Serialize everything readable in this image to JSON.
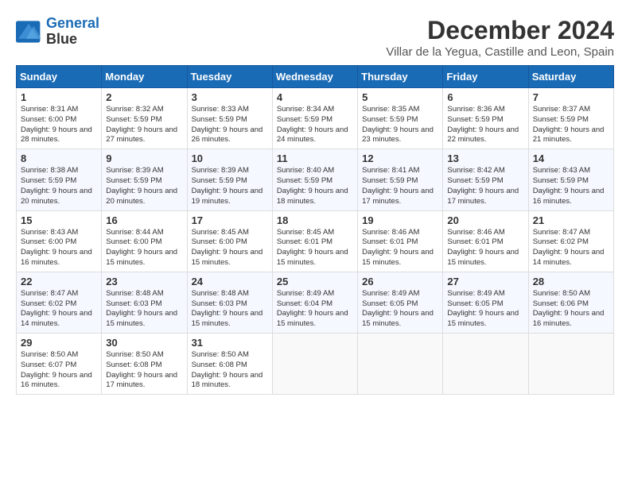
{
  "header": {
    "logo_line1": "General",
    "logo_line2": "Blue",
    "main_title": "December 2024",
    "subtitle": "Villar de la Yegua, Castille and Leon, Spain"
  },
  "weekdays": [
    "Sunday",
    "Monday",
    "Tuesday",
    "Wednesday",
    "Thursday",
    "Friday",
    "Saturday"
  ],
  "weeks": [
    [
      {
        "day": "1",
        "sunrise": "8:31 AM",
        "sunset": "6:00 PM",
        "daylight": "9 hours and 28 minutes."
      },
      {
        "day": "2",
        "sunrise": "8:32 AM",
        "sunset": "5:59 PM",
        "daylight": "9 hours and 27 minutes."
      },
      {
        "day": "3",
        "sunrise": "8:33 AM",
        "sunset": "5:59 PM",
        "daylight": "9 hours and 26 minutes."
      },
      {
        "day": "4",
        "sunrise": "8:34 AM",
        "sunset": "5:59 PM",
        "daylight": "9 hours and 24 minutes."
      },
      {
        "day": "5",
        "sunrise": "8:35 AM",
        "sunset": "5:59 PM",
        "daylight": "9 hours and 23 minutes."
      },
      {
        "day": "6",
        "sunrise": "8:36 AM",
        "sunset": "5:59 PM",
        "daylight": "9 hours and 22 minutes."
      },
      {
        "day": "7",
        "sunrise": "8:37 AM",
        "sunset": "5:59 PM",
        "daylight": "9 hours and 21 minutes."
      }
    ],
    [
      {
        "day": "8",
        "sunrise": "8:38 AM",
        "sunset": "5:59 PM",
        "daylight": "9 hours and 20 minutes."
      },
      {
        "day": "9",
        "sunrise": "8:39 AM",
        "sunset": "5:59 PM",
        "daylight": "9 hours and 20 minutes."
      },
      {
        "day": "10",
        "sunrise": "8:39 AM",
        "sunset": "5:59 PM",
        "daylight": "9 hours and 19 minutes."
      },
      {
        "day": "11",
        "sunrise": "8:40 AM",
        "sunset": "5:59 PM",
        "daylight": "9 hours and 18 minutes."
      },
      {
        "day": "12",
        "sunrise": "8:41 AM",
        "sunset": "5:59 PM",
        "daylight": "9 hours and 17 minutes."
      },
      {
        "day": "13",
        "sunrise": "8:42 AM",
        "sunset": "5:59 PM",
        "daylight": "9 hours and 17 minutes."
      },
      {
        "day": "14",
        "sunrise": "8:43 AM",
        "sunset": "5:59 PM",
        "daylight": "9 hours and 16 minutes."
      }
    ],
    [
      {
        "day": "15",
        "sunrise": "8:43 AM",
        "sunset": "6:00 PM",
        "daylight": "9 hours and 16 minutes."
      },
      {
        "day": "16",
        "sunrise": "8:44 AM",
        "sunset": "6:00 PM",
        "daylight": "9 hours and 15 minutes."
      },
      {
        "day": "17",
        "sunrise": "8:45 AM",
        "sunset": "6:00 PM",
        "daylight": "9 hours and 15 minutes."
      },
      {
        "day": "18",
        "sunrise": "8:45 AM",
        "sunset": "6:01 PM",
        "daylight": "9 hours and 15 minutes."
      },
      {
        "day": "19",
        "sunrise": "8:46 AM",
        "sunset": "6:01 PM",
        "daylight": "9 hours and 15 minutes."
      },
      {
        "day": "20",
        "sunrise": "8:46 AM",
        "sunset": "6:01 PM",
        "daylight": "9 hours and 15 minutes."
      },
      {
        "day": "21",
        "sunrise": "8:47 AM",
        "sunset": "6:02 PM",
        "daylight": "9 hours and 14 minutes."
      }
    ],
    [
      {
        "day": "22",
        "sunrise": "8:47 AM",
        "sunset": "6:02 PM",
        "daylight": "9 hours and 14 minutes."
      },
      {
        "day": "23",
        "sunrise": "8:48 AM",
        "sunset": "6:03 PM",
        "daylight": "9 hours and 15 minutes."
      },
      {
        "day": "24",
        "sunrise": "8:48 AM",
        "sunset": "6:03 PM",
        "daylight": "9 hours and 15 minutes."
      },
      {
        "day": "25",
        "sunrise": "8:49 AM",
        "sunset": "6:04 PM",
        "daylight": "9 hours and 15 minutes."
      },
      {
        "day": "26",
        "sunrise": "8:49 AM",
        "sunset": "6:05 PM",
        "daylight": "9 hours and 15 minutes."
      },
      {
        "day": "27",
        "sunrise": "8:49 AM",
        "sunset": "6:05 PM",
        "daylight": "9 hours and 15 minutes."
      },
      {
        "day": "28",
        "sunrise": "8:50 AM",
        "sunset": "6:06 PM",
        "daylight": "9 hours and 16 minutes."
      }
    ],
    [
      {
        "day": "29",
        "sunrise": "8:50 AM",
        "sunset": "6:07 PM",
        "daylight": "9 hours and 16 minutes."
      },
      {
        "day": "30",
        "sunrise": "8:50 AM",
        "sunset": "6:08 PM",
        "daylight": "9 hours and 17 minutes."
      },
      {
        "day": "31",
        "sunrise": "8:50 AM",
        "sunset": "6:08 PM",
        "daylight": "9 hours and 18 minutes."
      },
      null,
      null,
      null,
      null
    ]
  ],
  "labels": {
    "sunrise": "Sunrise:",
    "sunset": "Sunset:",
    "daylight": "Daylight:"
  }
}
